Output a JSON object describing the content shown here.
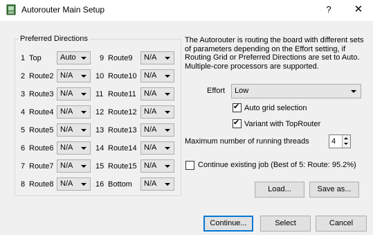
{
  "window": {
    "title": "Autorouter Main Setup",
    "help_glyph": "?",
    "close_glyph": "✕"
  },
  "preferred_directions": {
    "legend": "Preferred Directions",
    "left": [
      {
        "num": "1",
        "name": "Top",
        "value": "Auto"
      },
      {
        "num": "2",
        "name": "Route2",
        "value": "N/A"
      },
      {
        "num": "3",
        "name": "Route3",
        "value": "N/A"
      },
      {
        "num": "4",
        "name": "Route4",
        "value": "N/A"
      },
      {
        "num": "5",
        "name": "Route5",
        "value": "N/A"
      },
      {
        "num": "6",
        "name": "Route6",
        "value": "N/A"
      },
      {
        "num": "7",
        "name": "Route7",
        "value": "N/A"
      },
      {
        "num": "8",
        "name": "Route8",
        "value": "N/A"
      }
    ],
    "right": [
      {
        "num": "9",
        "name": "Route9",
        "value": "N/A"
      },
      {
        "num": "10",
        "name": "Route10",
        "value": "N/A"
      },
      {
        "num": "11",
        "name": "Route11",
        "value": "N/A"
      },
      {
        "num": "12",
        "name": "Route12",
        "value": "N/A"
      },
      {
        "num": "13",
        "name": "Route13",
        "value": "N/A"
      },
      {
        "num": "14",
        "name": "Route14",
        "value": "N/A"
      },
      {
        "num": "15",
        "name": "Route15",
        "value": "N/A"
      },
      {
        "num": "16",
        "name": "Bottom",
        "value": "N/A"
      }
    ]
  },
  "description": "The Autorouter is routing the board with different sets of parameters depending on the Effort setting, if Routing Grid or Preferred Directions are set to Auto. Multiple-core processors are supported.",
  "effort": {
    "label": "Effort",
    "value": "Low"
  },
  "auto_grid": {
    "label": "Auto grid selection",
    "checked_glyph": "✔"
  },
  "variant": {
    "label": "Variant with TopRouter",
    "checked_glyph": "✔"
  },
  "threads": {
    "label": "Maximum number of running threads",
    "value": "4"
  },
  "continue_job": {
    "label": "Continue existing job (Best of 5: Route: 95.2%)"
  },
  "buttons": {
    "load": "Load...",
    "save_as": "Save as...",
    "continue": "Continue...",
    "select": "Select",
    "cancel": "Cancel"
  }
}
